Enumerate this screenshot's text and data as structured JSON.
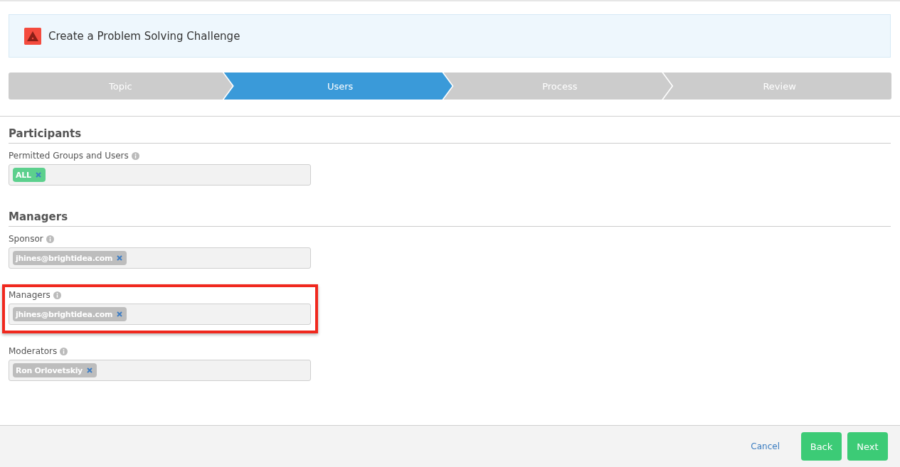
{
  "header": {
    "title": "Create a Problem Solving Challenge"
  },
  "steps": [
    {
      "label": "Topic",
      "selected": false
    },
    {
      "label": "Users",
      "selected": true
    },
    {
      "label": "Process",
      "selected": false
    },
    {
      "label": "Review",
      "selected": false
    }
  ],
  "sections": [
    {
      "title": "Participants",
      "fields": [
        {
          "label": "Permitted Groups and Users",
          "highlighted": false,
          "tags": [
            {
              "text": "ALL",
              "color": "#5cd08d"
            }
          ]
        }
      ]
    },
    {
      "title": "Managers",
      "fields": [
        {
          "label": "Sponsor",
          "highlighted": false,
          "tags": [
            {
              "text": "jhines@brightidea.com",
              "color": "#bdbdbd"
            }
          ]
        },
        {
          "label": "Managers",
          "highlighted": true,
          "tags": [
            {
              "text": "jhines@brightidea.com",
              "color": "#bdbdbd"
            }
          ]
        },
        {
          "label": "Moderators",
          "highlighted": false,
          "tags": [
            {
              "text": "Ron Orlovetskiy",
              "color": "#bdbdbd"
            }
          ]
        }
      ]
    }
  ],
  "footer": {
    "cancel": "Cancel",
    "buttons": [
      "Back",
      "Next"
    ]
  }
}
